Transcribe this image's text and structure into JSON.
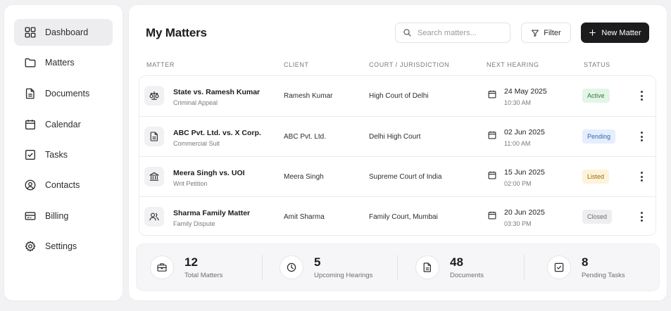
{
  "sidebar": {
    "items": [
      {
        "label": "Dashboard",
        "icon": "grid-icon",
        "active": true
      },
      {
        "label": "Matters",
        "icon": "folder-icon",
        "active": false
      },
      {
        "label": "Documents",
        "icon": "document-icon",
        "active": false
      },
      {
        "label": "Calendar",
        "icon": "calendar-icon",
        "active": false
      },
      {
        "label": "Tasks",
        "icon": "checkbox-icon",
        "active": false
      },
      {
        "label": "Contacts",
        "icon": "user-circle-icon",
        "active": false
      },
      {
        "label": "Billing",
        "icon": "card-icon",
        "active": false
      },
      {
        "label": "Settings",
        "icon": "gear-icon",
        "active": false
      }
    ]
  },
  "header": {
    "title": "My Matters",
    "search_placeholder": "Search matters...",
    "filter_label": "Filter",
    "new_label": "New Matter"
  },
  "table": {
    "columns": [
      "MATTER",
      "CLIENT",
      "COURT / JURISDICTION",
      "NEXT HEARING",
      "STATUS"
    ],
    "rows": [
      {
        "title": "State vs. Ramesh Kumar",
        "type": "Criminal Appeal",
        "client": "Ramesh Kumar",
        "court": "High Court of Delhi",
        "date": "24 May 2025",
        "time": "10:30 AM",
        "status": "Active",
        "icon": "scales-icon"
      },
      {
        "title": "ABC Pvt. Ltd. vs. X Corp.",
        "type": "Commercial Suit",
        "client": "ABC Pvt. Ltd.",
        "court": "Delhi High Court",
        "date": "02 Jun 2025",
        "time": "11:00 AM",
        "status": "Pending",
        "icon": "document-icon"
      },
      {
        "title": "Meera Singh vs. UOI",
        "type": "Writ Petition",
        "client": "Meera Singh",
        "court": "Supreme Court of India",
        "date": "15 Jun 2025",
        "time": "02:00 PM",
        "status": "Listed",
        "icon": "courthouse-icon"
      },
      {
        "title": "Sharma Family Matter",
        "type": "Family Dispute",
        "client": "Amit Sharma",
        "court": "Family Court, Mumbai",
        "date": "20 Jun 2025",
        "time": "03:30 PM",
        "status": "Closed",
        "icon": "users-icon"
      }
    ]
  },
  "status_colors": {
    "Active": {
      "bg": "#e3f5e6",
      "fg": "#2f7a3e"
    },
    "Pending": {
      "bg": "#e4eefc",
      "fg": "#3566b5"
    },
    "Listed": {
      "bg": "#fdf3d9",
      "fg": "#9a6a10"
    },
    "Closed": {
      "bg": "#eeeef0",
      "fg": "#6e6e73"
    }
  },
  "stats": [
    {
      "value": "12",
      "label": "Total Matters",
      "icon": "briefcase-icon"
    },
    {
      "value": "5",
      "label": "Upcoming Hearings",
      "icon": "clock-icon"
    },
    {
      "value": "48",
      "label": "Documents",
      "icon": "document-icon"
    },
    {
      "value": "8",
      "label": "Pending Tasks",
      "icon": "checkbox-icon"
    }
  ]
}
